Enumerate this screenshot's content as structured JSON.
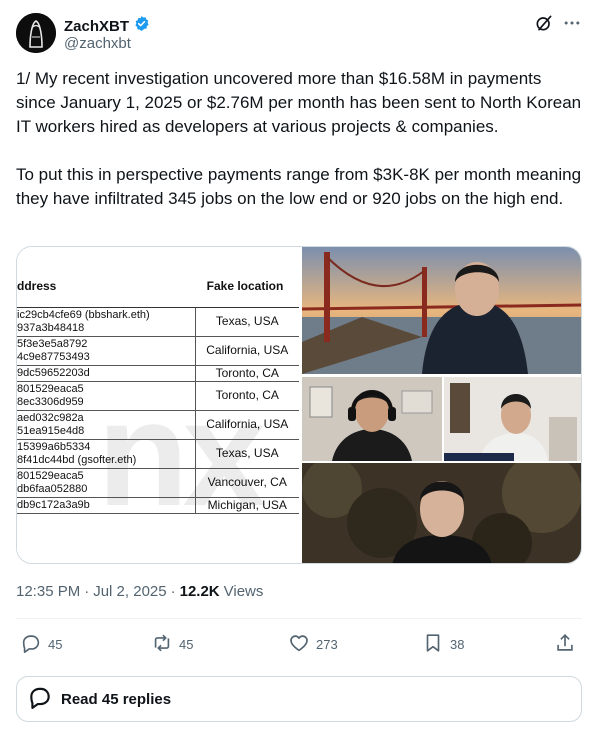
{
  "author": {
    "display_name": "ZachXBT",
    "handle": "@zachxbt",
    "verified_icon": "verified-badge-icon"
  },
  "header_icons": [
    "grok-icon",
    "more-icon"
  ],
  "tweet": {
    "text": "1/ My recent investigation uncovered more than $16.58M in payments since January 1, 2025 or $2.76M per month has been sent to North Korean IT workers hired as developers at various projects & companies.\n\nTo put this in perspective payments range from $3K-8K per month meaning they have infiltrated 345 jobs on the low end or 920 jobs on the high end."
  },
  "media_table": {
    "col_address": "ddress",
    "col_location": "Fake location",
    "rows": [
      {
        "addr1": "ic29cb4cfe69 (bbshark.eth)",
        "addr2": "937a3b48418",
        "loc": "Texas, USA"
      },
      {
        "addr1": "5f3e3e5a8792",
        "addr2": "4c9e87753493",
        "loc": "California, USA"
      },
      {
        "addr1": "9dc59652203d",
        "addr2": "",
        "loc": "Toronto, CA"
      },
      {
        "addr1": "801529eaca5",
        "addr2": "8ec3306d959",
        "loc": "Toronto, CA"
      },
      {
        "addr1": "aed032c982a",
        "addr2": "51ea915e4d8",
        "loc": "California, USA"
      },
      {
        "addr1": "15399a6b5334",
        "addr2": "8f41dc44bd (gsofter.eth)",
        "loc": "Texas, USA"
      },
      {
        "addr1": "801529eaca5",
        "addr2": "db6faa052880",
        "loc": "Vancouver, CA"
      },
      {
        "addr1": "db9c172a3a9b",
        "addr2": "",
        "loc": "Michigan, USA"
      }
    ]
  },
  "meta": {
    "time": "12:35 PM",
    "sep1": "·",
    "date": "Jul 2, 2025",
    "sep2": "·",
    "views_count": "12.2K",
    "views_label": "Views"
  },
  "actions": {
    "replies": "45",
    "reposts": "45",
    "likes": "273",
    "bookmarks": "38"
  },
  "read_replies_label": "Read 45 replies"
}
